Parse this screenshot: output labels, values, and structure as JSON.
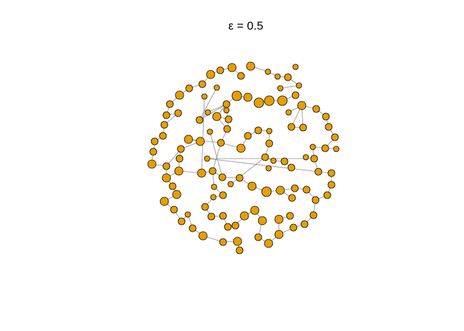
{
  "title": "ε = 0.5",
  "colors": {
    "node_fill": "#E69F00",
    "node_stroke": "#000000",
    "edge": "#8a8a8a",
    "background": "#ffffff"
  },
  "graph": {
    "node_count": 116
  }
}
